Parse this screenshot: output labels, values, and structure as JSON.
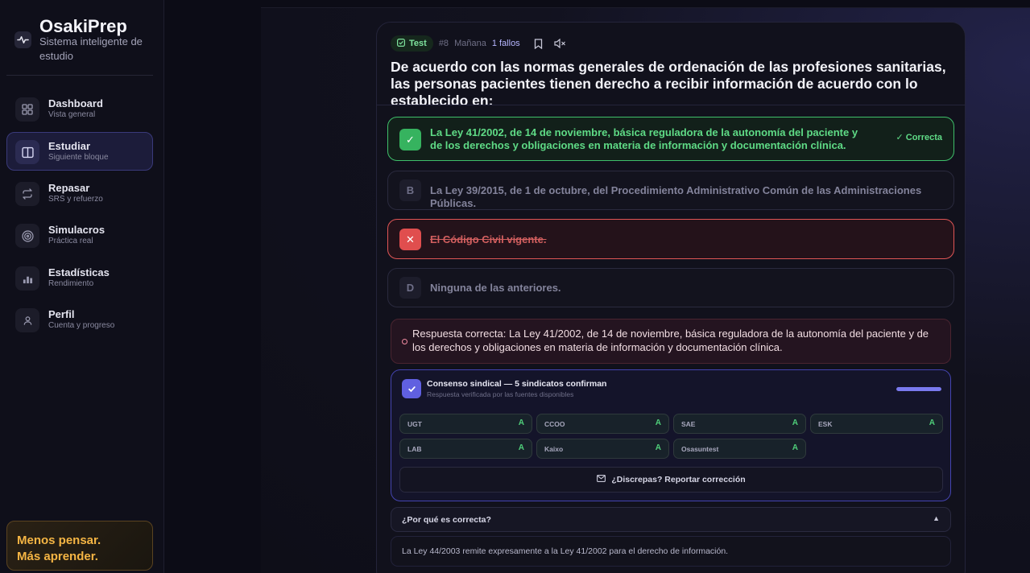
{
  "sidebar": {
    "brand": {
      "title": "OsakiPrep",
      "subtitle": "Sistema inteligente de estudio",
      "icon": "pulse-icon"
    },
    "items": [
      {
        "title": "Dashboard",
        "subtitle": "Vista general",
        "icon": "grid-icon",
        "active": false
      },
      {
        "title": "Estudiar",
        "subtitle": "Siguiente bloque",
        "icon": "book-icon",
        "active": true
      },
      {
        "title": "Repasar",
        "subtitle": "SRS y refuerzo",
        "icon": "repeat-icon",
        "active": false
      },
      {
        "title": "Simulacros",
        "subtitle": "Práctica real",
        "icon": "target-icon",
        "active": false
      },
      {
        "title": "Estadísticas",
        "subtitle": "Rendimiento",
        "icon": "bar-chart-icon",
        "active": false
      },
      {
        "title": "Perfil",
        "subtitle": "Cuenta y progreso",
        "icon": "user-icon",
        "active": false
      }
    ],
    "promo": {
      "line1": "Menos pensar.",
      "line2": "Más aprender."
    }
  },
  "question": {
    "badge": "Test",
    "number": "#8",
    "schedule": "Mañana",
    "fails": "1 fallos",
    "text": "De acuerdo con las normas generales de ordenación de las profesiones sanitarias, las personas pacientes tienen derecho a recibir información de acuerdo con lo establecido en:"
  },
  "options": [
    {
      "letter": "A",
      "mark": "✓",
      "text": "La Ley 41/2002, de 14 de noviembre, básica reguladora de la autonomía del paciente y de los derechos y obligaciones en materia de información y documentación clínica.",
      "state": "correct",
      "tag": "✓ Correcta"
    },
    {
      "letter": "B",
      "mark": "B",
      "text": "La Ley 39/2015, de 1 de octubre, del Procedimiento Administrativo Común de las Administraciones Públicas.",
      "state": "neutral"
    },
    {
      "letter": "C",
      "mark": "✕",
      "text": "El Código Civil vigente.",
      "state": "wrong"
    },
    {
      "letter": "D",
      "mark": "D",
      "text": "Ninguna de las anteriores.",
      "state": "neutral"
    }
  ],
  "answer_box": {
    "text": "Respuesta correcta: La Ley 41/2002, de 14 de noviembre, básica reguladora de la autonomía del paciente y de los derechos y obligaciones en materia de información y documentación clínica."
  },
  "consensus": {
    "title": "Consenso sindical — 5 sindicatos confirman",
    "subtitle": "Respuesta verificada por las fuentes disponibles",
    "progress": 1.0,
    "unions": [
      {
        "name": "UGT",
        "answer": "A"
      },
      {
        "name": "CCOO",
        "answer": "A"
      },
      {
        "name": "SAE",
        "answer": "A"
      },
      {
        "name": "ESK",
        "answer": "A"
      },
      {
        "name": "LAB",
        "answer": "A"
      },
      {
        "name": "Kaixo",
        "answer": "A"
      },
      {
        "name": "Osasuntest",
        "answer": "A"
      }
    ],
    "report_label": "¿Discrepas? Reportar corrección"
  },
  "why": {
    "label": "¿Por qué es correcta?",
    "caret": "▲",
    "explanation": "La Ley 44/2003 remite expresamente a la Ley 41/2002 para el derecho de información."
  },
  "colors": {
    "accent": "#6060e0",
    "correct": "#36b35f",
    "wrong": "#e04e4e",
    "promo": "#f5b544"
  }
}
